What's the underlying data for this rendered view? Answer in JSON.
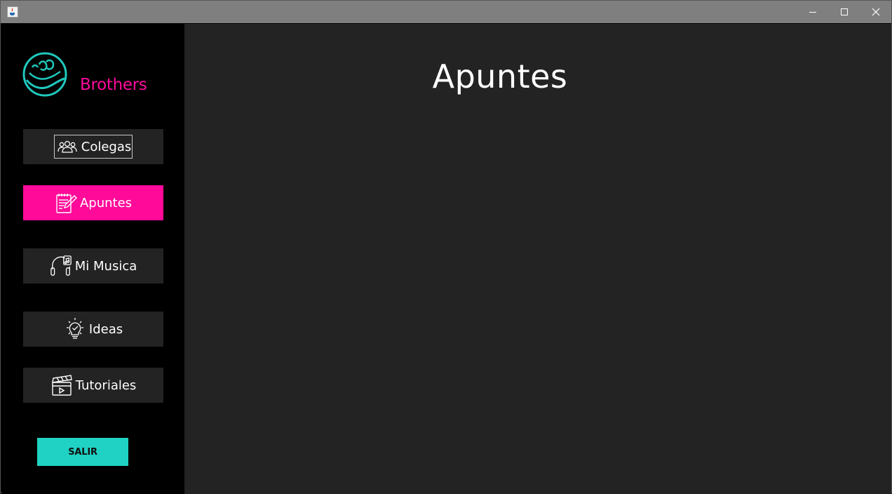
{
  "window": {
    "controls": {
      "minimize": "minimize-icon",
      "maximize": "maximize-icon",
      "close": "close-icon"
    },
    "app_icon": "java-cup-icon"
  },
  "sidebar": {
    "brand": "Brothers",
    "logo_icon": "brothers-logo",
    "items": [
      {
        "label": "Colegas",
        "icon": "group-icon",
        "active": false,
        "focused": true
      },
      {
        "label": "Apuntes",
        "icon": "notepad-pencil-icon",
        "active": true
      },
      {
        "label": "Mi Musica",
        "icon": "headphones-icon",
        "active": false
      },
      {
        "label": "Ideas",
        "icon": "lightbulb-icon",
        "active": false
      },
      {
        "label": "Tutoriales",
        "icon": "clapperboard-icon",
        "active": false
      }
    ],
    "exit_label": "SALIR"
  },
  "main": {
    "title": "Apuntes"
  },
  "colors": {
    "accent_pink": "#ff0a99",
    "accent_teal": "#1fd2c3",
    "sidebar_bg": "#000000",
    "panel_bg": "#232323",
    "item_bg": "#232323"
  }
}
